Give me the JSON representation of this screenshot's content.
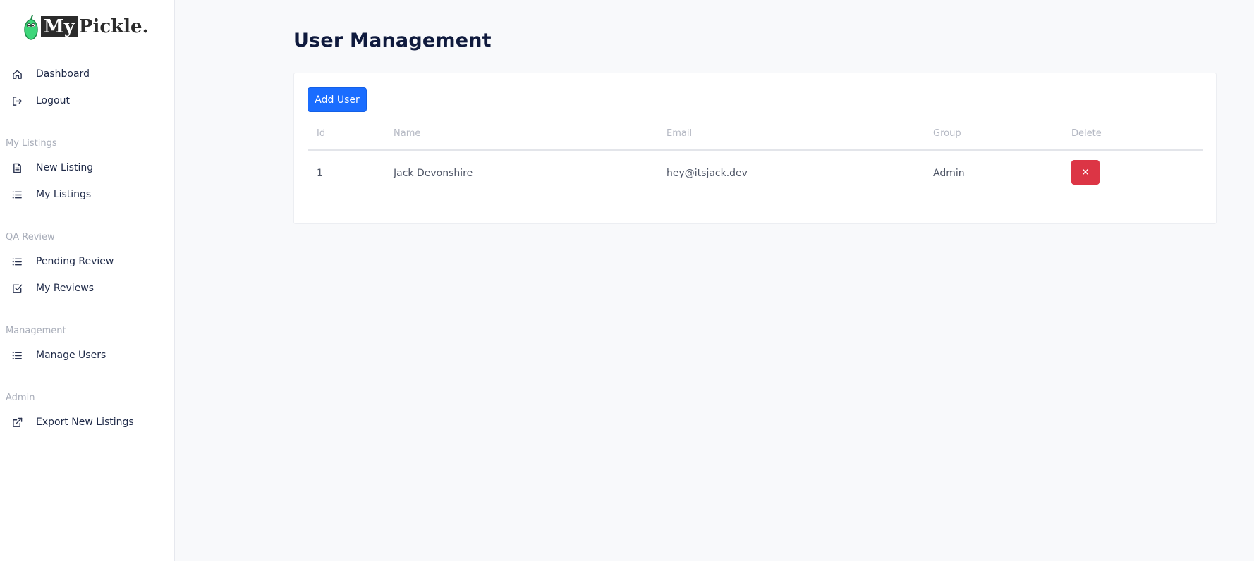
{
  "brand": {
    "my": "My",
    "rest": "Pickle."
  },
  "sidebar": {
    "top_items": [
      {
        "label": "Dashboard",
        "icon": "home-icon"
      },
      {
        "label": "Logout",
        "icon": "logout-icon"
      }
    ],
    "sections": [
      {
        "title": "My Listings",
        "items": [
          {
            "label": "New Listing",
            "icon": "document-icon"
          },
          {
            "label": "My Listings",
            "icon": "list-icon"
          }
        ]
      },
      {
        "title": "QA Review",
        "items": [
          {
            "label": "Pending Review",
            "icon": "list-icon"
          },
          {
            "label": "My Reviews",
            "icon": "check-square-icon"
          }
        ]
      },
      {
        "title": "Management",
        "items": [
          {
            "label": "Manage Users",
            "icon": "list-icon"
          }
        ]
      },
      {
        "title": "Admin",
        "items": [
          {
            "label": "Export New Listings",
            "icon": "external-link-icon"
          }
        ]
      }
    ]
  },
  "main": {
    "title": "User Management",
    "add_user_label": "Add User",
    "table": {
      "headers": [
        "Id",
        "Name",
        "Email",
        "Group",
        "Delete"
      ],
      "rows": [
        {
          "id": "1",
          "name": "Jack Devonshire",
          "email": "hey@itsjack.dev",
          "group": "Admin",
          "delete_symbol": "✕"
        }
      ]
    }
  },
  "colors": {
    "primary": "#1a6dff",
    "danger": "#dc3545",
    "logo_green": "#3ed67a"
  }
}
